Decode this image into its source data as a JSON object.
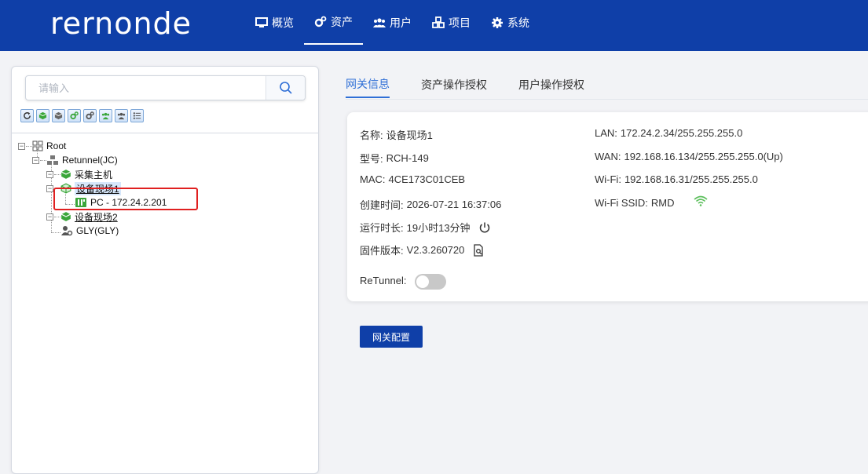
{
  "header": {
    "logo": "rernonde",
    "nav": [
      {
        "label": "概览",
        "icon": "monitor-icon"
      },
      {
        "label": "资产",
        "icon": "cogs-icon"
      },
      {
        "label": "用户",
        "icon": "users-icon"
      },
      {
        "label": "项目",
        "icon": "cubes-icon"
      },
      {
        "label": "系统",
        "icon": "gear-icon"
      }
    ],
    "active_nav": "资产"
  },
  "sidebar": {
    "search": {
      "placeholder": "请输入",
      "value": ""
    },
    "toolbar": [
      "refresh-icon",
      "cube-green-icon",
      "cube-gray-icon",
      "cogs-green-icon",
      "cogs-gray-icon",
      "users-green-icon",
      "users-gray-icon",
      "list-icon"
    ],
    "tree": {
      "root": "Root",
      "retunnel": "Retunnel(JC)",
      "host": "采集主机",
      "site1": "设备现场1",
      "pc": "PC - 172.24.2.201",
      "site2": "设备现场2",
      "gly": "GLY(GLY)"
    }
  },
  "tabs": [
    "网关信息",
    "资产操作授权",
    "用户操作授权"
  ],
  "active_tab": "网关信息",
  "gateway": {
    "name_k": "名称:",
    "name_v": "设备现场1",
    "model_k": "型号:",
    "model_v": "RCH-149",
    "mac_k": "MAC:",
    "mac_v": "4CE173C01CEB",
    "created_k": "创建时间:",
    "created_v": "2026-07-21 16:37:06",
    "uptime_k": "运行时长:",
    "uptime_v": "19小时13分钟",
    "fw_k": "固件版本:",
    "fw_v": "V2.3.260720",
    "lan_k": "LAN:",
    "lan_v": "172.24.2.34/255.255.255.0",
    "wan_k": "WAN:",
    "wan_v": "192.168.16.134/255.255.255.0(Up)",
    "wifi_k": "Wi-Fi:",
    "wifi_v": "192.168.16.31/255.255.255.0",
    "ssid_k": "Wi-Fi SSID:",
    "ssid_v": "RMD",
    "retunnel_k": "ReTunnel:",
    "retunnel_on": false
  },
  "config_button": "网关配置",
  "colors": {
    "brand": "#0f3fa8",
    "accent": "#2f6fd6",
    "highlight": "#e02020",
    "green": "#3aa63a"
  }
}
